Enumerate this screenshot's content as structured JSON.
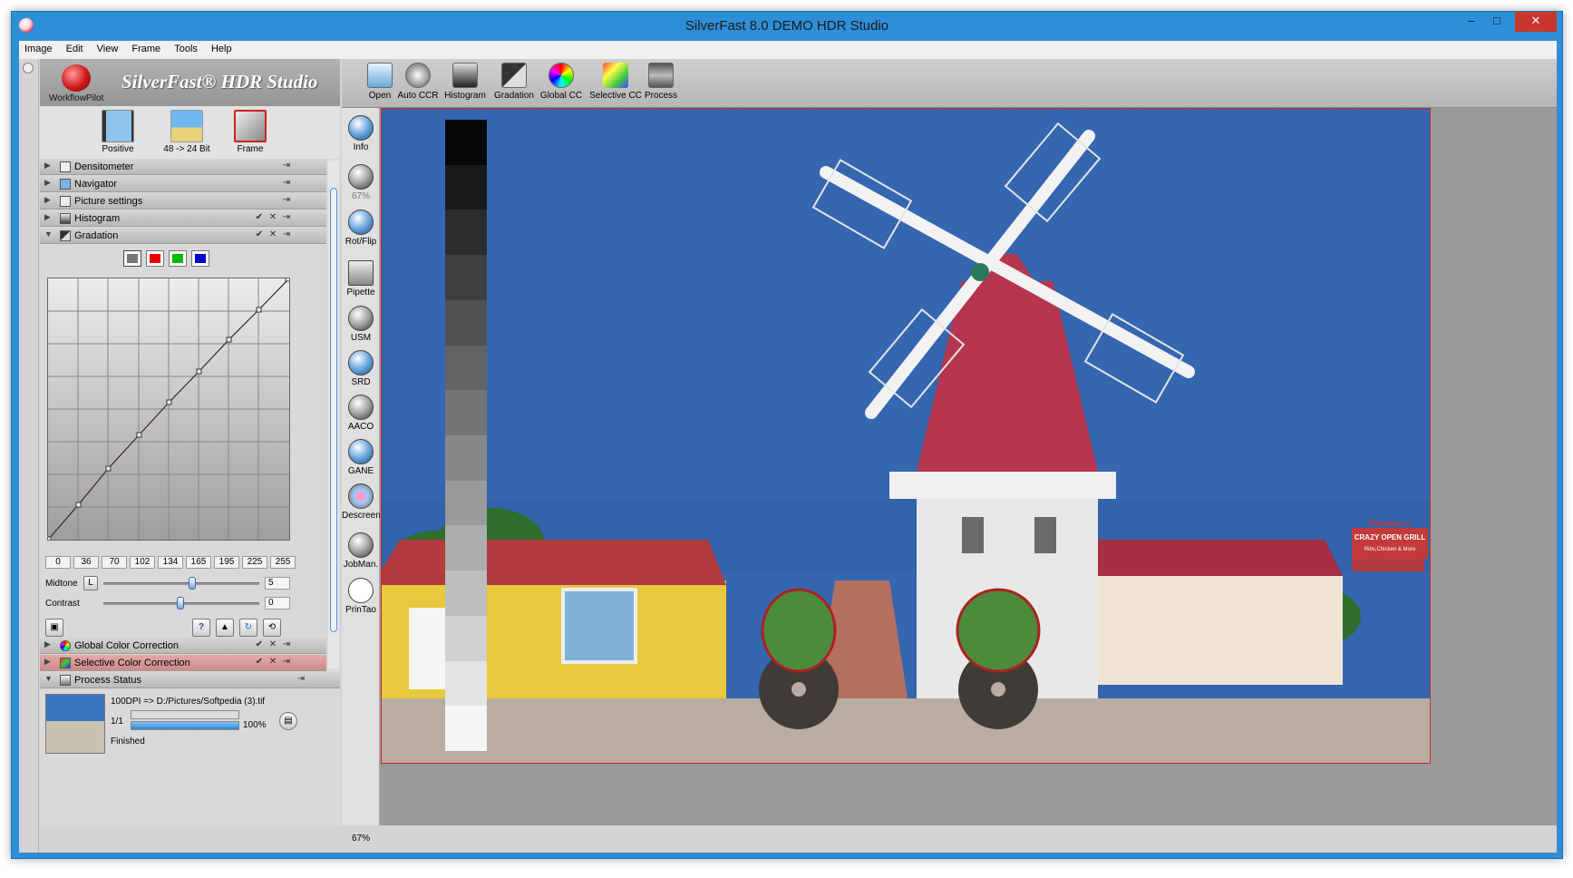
{
  "window": {
    "title": "SilverFast 8.0 DEMO  HDR Studio",
    "min": "–",
    "max": "□",
    "close": "✕"
  },
  "menu": [
    "Image",
    "Edit",
    "View",
    "Frame",
    "Tools",
    "Help"
  ],
  "logo": {
    "text": "SilverFast® HDR Studio",
    "workflow_label": "WorkflowPilot"
  },
  "modes": [
    {
      "label": "Positive"
    },
    {
      "label": "48 -> 24 Bit"
    },
    {
      "label": "Frame"
    }
  ],
  "sections": {
    "densitometer": "Densitometer",
    "navigator": "Navigator",
    "picture_settings": "Picture settings",
    "histogram": "Histogram",
    "gradation": "Gradation",
    "global_cc": "Global Color Correction",
    "selective_cc": "Selective Color Correction",
    "process_status": "Process Status"
  },
  "gradation": {
    "values": [
      "0",
      "36",
      "70",
      "102",
      "134",
      "165",
      "195",
      "225",
      "255"
    ],
    "midtone_label": "Midtone",
    "midtone_mode": "L",
    "midtone_value": "5",
    "contrast_label": "Contrast",
    "contrast_value": "0",
    "help": "?"
  },
  "status": {
    "line": "100DPI => D:/Pictures/Softpedia (3).tif",
    "count": "1/1",
    "percent": "100%",
    "progress": 1.0,
    "state": "Finished"
  },
  "tools": [
    "Info",
    "67%",
    "Rot/Flip",
    "Pipette",
    "USM",
    "SRD",
    "AACO",
    "GANE",
    "Descreen",
    "JobMan.",
    "PrinTao"
  ],
  "toolbar": [
    "Open",
    "Auto CCR",
    "Histogram",
    "Gradation",
    "Global CC",
    "Selective CC",
    "Process"
  ],
  "zoom": "67%",
  "photo_signs": {
    "grill": "CRAZY OPEN GRILL",
    "grill_sub": "Ribs,Chicken & More",
    "brand": "Eleonora's"
  },
  "colors": {
    "title_bar": "#2e8fd8",
    "selection": "#d02828",
    "sky": "#3b6db5"
  }
}
